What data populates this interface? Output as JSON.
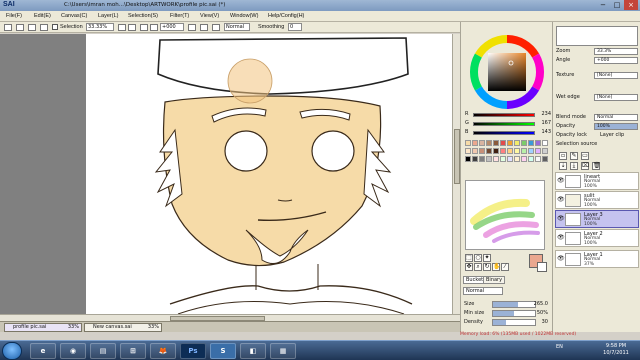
{
  "window": {
    "app_logo": "SAI",
    "title": "C:\\Users\\imran moh...\\Desktop\\ARTWORK\\profile pic.sai (*)",
    "controls": [
      "−",
      "□",
      "×"
    ]
  },
  "menu": {
    "items": [
      "File",
      "Edit",
      "Canvas",
      "Layer",
      "Selection",
      "Filter",
      "View",
      "Window",
      "Help/Config"
    ],
    "accelerators": [
      "(F)",
      "(E)",
      "(C)",
      "(L)",
      "(S)",
      "(T)",
      "(V)",
      "(W)",
      "(H)"
    ]
  },
  "options_bar": {
    "selection_label": "Selection",
    "zoom": "33.33%",
    "angle": "+000",
    "mode": "Normal",
    "smoothing_label": "Smoothing",
    "smoothing_value": "0"
  },
  "color_panel": {
    "sliders": [
      {
        "label": "R",
        "value": "234"
      },
      {
        "label": "G",
        "value": "167"
      },
      {
        "label": "B",
        "value": "143"
      }
    ],
    "current_color": "#eaa78f",
    "secondary_color": "#ffffff",
    "tool_tabs": [
      "Bucket",
      "Binary"
    ],
    "mode_value": "Normal",
    "props": [
      {
        "label": "Size",
        "value": "265.0",
        "fill": 0.6
      },
      {
        "label": "Min size",
        "value": "50%",
        "fill": 0.5
      },
      {
        "label": "Density",
        "value": "30",
        "fill": 0.3
      }
    ]
  },
  "layer_panel": {
    "zoom_label": "Zoom",
    "zoom_value": "33.3%",
    "angle_label": "Angle",
    "angle_value": "+000",
    "texture_label": "Texture",
    "texture_value": "[None]",
    "effect_label": "Wet edge",
    "effect_value": "[None]",
    "blend_label": "Blend mode",
    "blend_value": "Normal",
    "opacity_label": "Opacity",
    "opacity_value": "100%",
    "preserve_opacity": "Opacity lock",
    "clip_label": "Layer clip",
    "selection_source": "Selection source",
    "layers": [
      {
        "name": "lineart",
        "mode": "Normal",
        "opacity": "100%",
        "selected": false
      },
      {
        "name": "sulit",
        "mode": "Normal",
        "opacity": "100%",
        "selected": false
      },
      {
        "name": "Layer 3",
        "mode": "Normal",
        "opacity": "100%",
        "selected": true
      },
      {
        "name": "Layer 2",
        "mode": "Normal",
        "opacity": "100%",
        "selected": false
      },
      {
        "name": "Layer 1",
        "mode": "Normal",
        "opacity": "37%",
        "selected": false
      }
    ]
  },
  "file_tabs": [
    {
      "name": "profile pic.sai",
      "zoom": "33%",
      "active": true
    },
    {
      "name": "New canvas.sai",
      "zoom": "33%",
      "active": false
    }
  ],
  "status": {
    "memory": "Memory load: 6% (135MB used / 1022MB reserved)"
  },
  "taskbar": {
    "apps": [
      "e",
      "◉",
      "▤",
      "⊞",
      "🦊",
      "Ps",
      "S",
      "◧",
      "▦"
    ],
    "lang": "EN",
    "time": "9:58 PM",
    "date": "10/7/2011"
  }
}
